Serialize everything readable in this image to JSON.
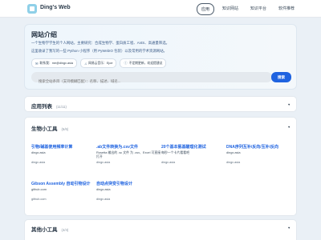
{
  "header": {
    "brand": "Ding's Web",
    "nav": [
      "应用",
      "知识网站",
      "知识平台",
      "软件推荐"
    ]
  },
  "intro": {
    "title": "网站介绍",
    "lines": [
      "一个生物学学生的个人网站，主要研究：合成生物学、蛋白质工程、AI4S、高通量筛选。",
      "这里收录了我写的一些 Python 小程序（用 PyWebIO 包装）以及常用的学术资源网站。"
    ],
    "badges": [
      {
        "icon": "✉",
        "text": "联系我：me@dingx.asia"
      },
      {
        "icon": "♫",
        "text": "网易云音乐：Ejoe"
      },
      {
        "icon": "ⓘ",
        "text": "不定期更新，欢迎提建议"
      }
    ],
    "search_placeholder": "搜索全站条目（支持模糊匹配）：名称、描述、域名...",
    "search_button": "搜索"
  },
  "app_list": {
    "title": "应用列表",
    "count": "(11/11)"
  },
  "tools": {
    "title": "生物小工具",
    "count": "(6/6)",
    "cards": [
      {
        "title": "引物/碱基使用频率计算",
        "desc": "dingx.asia",
        "domain": "dingx.asia"
      },
      {
        "title": ".ab文件转换为.csv文件",
        "desc": "Rosetta 输出的 .sc 文件 为 .csv、Excel 可直接打开",
        "domain": "dingx.asia"
      },
      {
        "title": "20个基本氨基酸理化测试",
        "desc": "每秒一个卡片看看吧",
        "domain": "dingx.asia"
      },
      {
        "title": "DNA序列互补/反向/互补/反向",
        "desc": "dingx.asia",
        "domain": "dingx.asia"
      },
      {
        "title": "Gibson Assembly 自动引物设计",
        "desc": "github.com",
        "domain": "github.com"
      },
      {
        "title": "自动点突变引物设计",
        "desc": "dingx.asia",
        "domain": "dingx.asia"
      }
    ]
  },
  "other": {
    "title": "其他小工具",
    "count": "(4/4)"
  },
  "colors": {
    "accent": "#1f63e0",
    "link": "#1f63e0",
    "intro_text": "#3b5b88"
  }
}
